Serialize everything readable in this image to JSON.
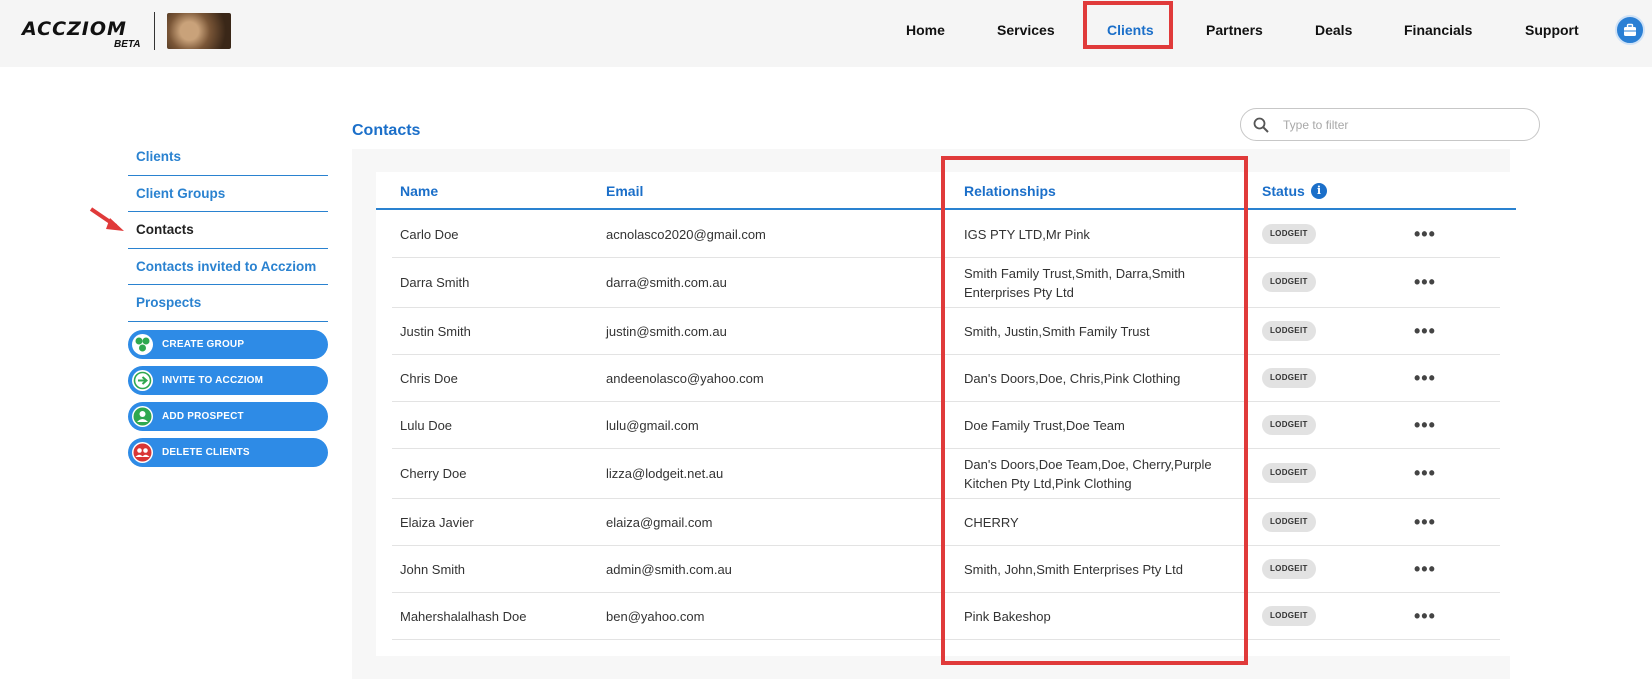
{
  "brand": {
    "name": "ACCZIOM",
    "beta": "BETA"
  },
  "nav": {
    "items": [
      {
        "label": "Home"
      },
      {
        "label": "Services"
      },
      {
        "label": "Clients"
      },
      {
        "label": "Partners"
      },
      {
        "label": "Deals"
      },
      {
        "label": "Financials"
      },
      {
        "label": "Support"
      }
    ],
    "active": "Clients",
    "profile_icon": "briefcase-icon"
  },
  "sidebar": {
    "links": [
      {
        "label": "Clients"
      },
      {
        "label": "Client Groups"
      },
      {
        "label": "Contacts"
      },
      {
        "label": "Contacts invited to Accziom"
      },
      {
        "label": "Prospects"
      }
    ],
    "active": "Contacts",
    "buttons": [
      {
        "label": "CREATE GROUP",
        "icon": "group-icon"
      },
      {
        "label": "INVITE TO ACCZIOM",
        "icon": "arrow-right-icon"
      },
      {
        "label": "ADD PROSPECT",
        "icon": "person-icon"
      },
      {
        "label": "DELETE CLIENTS",
        "icon": "people-icon"
      }
    ]
  },
  "main": {
    "title": "Contacts",
    "filter_placeholder": "Type to filter",
    "columns": {
      "name": "Name",
      "email": "Email",
      "relationships": "Relationships",
      "status": "Status"
    },
    "rows": [
      {
        "name": "Carlo Doe",
        "email": "acnolasco2020@gmail.com",
        "relationships": "IGS PTY LTD,Mr Pink",
        "status": "LODGEIT"
      },
      {
        "name": "Darra Smith",
        "email": "darra@smith.com.au",
        "relationships": "Smith Family Trust,Smith, Darra,Smith Enterprises Pty Ltd",
        "status": "LODGEIT"
      },
      {
        "name": "Justin Smith",
        "email": "justin@smith.com.au",
        "relationships": "Smith, Justin,Smith Family Trust",
        "status": "LODGEIT"
      },
      {
        "name": "Chris Doe",
        "email": "andeenolasco@yahoo.com",
        "relationships": "Dan's Doors,Doe, Chris,Pink Clothing",
        "status": "LODGEIT"
      },
      {
        "name": "Lulu Doe",
        "email": "lulu@gmail.com",
        "relationships": "Doe Family Trust,Doe Team",
        "status": "LODGEIT"
      },
      {
        "name": "Cherry Doe",
        "email": "lizza@lodgeit.net.au",
        "relationships": "Dan's Doors,Doe Team,Doe, Cherry,Purple Kitchen Pty Ltd,Pink Clothing",
        "status": "LODGEIT"
      },
      {
        "name": "Elaiza Javier",
        "email": "elaiza@gmail.com",
        "relationships": "CHERRY",
        "status": "LODGEIT"
      },
      {
        "name": "John Smith",
        "email": "admin@smith.com.au",
        "relationships": "Smith, John,Smith Enterprises Pty Ltd",
        "status": "LODGEIT"
      },
      {
        "name": "Mahershalalhash Doe",
        "email": "ben@yahoo.com",
        "relationships": "Pink Bakeshop",
        "status": "LODGEIT"
      }
    ]
  },
  "colors": {
    "accent": "#1b6fc9",
    "button": "#2e8be6",
    "highlight": "#e03a3a"
  }
}
